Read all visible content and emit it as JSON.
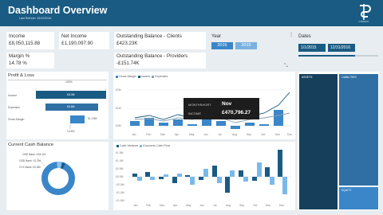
{
  "header": {
    "title": "Dashboard Overview",
    "subtitle": "Last Refresh: 26/12/2016",
    "logo_text": "COMPANY"
  },
  "kpis": {
    "income": {
      "label": "Income",
      "value": "£8,050,115.88"
    },
    "net_income": {
      "label": "Net Income",
      "value": "£1,190,097.90"
    },
    "margin": {
      "label": "Margin %",
      "value": "14.78 %"
    },
    "outstanding_clients": {
      "label": "Outstanding Balance - Clients",
      "value": "£423.23K"
    },
    "outstanding_providers": {
      "label": "Outstanding Balance - Providers",
      "value": "-£151.74K"
    }
  },
  "year": {
    "label": "Year",
    "options": [
      "2016",
      "2015"
    ],
    "selected": "2016"
  },
  "dates": {
    "label": "Dates",
    "start": "1/1/2015",
    "end": "12/31/2016"
  },
  "profit_loss": {
    "title": "Profit & Loss",
    "top_pct": "100%",
    "rows": [
      {
        "label": "Income",
        "value": "£8.0M"
      },
      {
        "label": "Expenses",
        "value": "£6.8M"
      },
      {
        "label": "Gross Margin",
        "value": "£1.19M"
      }
    ],
    "bottom_pct": "14.8%"
  },
  "income_chart": {
    "legend": [
      "Gross Margin",
      "Income",
      "Expenses"
    ],
    "y_ticks": [
      "£2M",
      "£1M",
      "£0M"
    ],
    "months": [
      "Jan",
      "Feb",
      "Mar",
      "Apr",
      "May",
      "Jun",
      "Jul",
      "Aug",
      "Sep",
      "Oct",
      "Nov",
      "Dec"
    ]
  },
  "tooltip": {
    "month_key": "MONTHSHORT",
    "month_val": "Nov",
    "income_key": "INCOME",
    "income_val": "£470,796.27"
  },
  "cash_balance": {
    "title": "Current Cash Balance",
    "labels": [
      "CBD Bank: £18.1M",
      "CBD Bank: £1.2M",
      "XYZ Bank: £0.8M"
    ]
  },
  "cashflow_chart": {
    "legend": [
      "Cash Variance",
      "Economic Cash Flow"
    ],
    "y_ticks": [
      "£1.5M",
      "£1.0M",
      "£0.5M",
      "£0.0M",
      "-£0.5M",
      "-£1.0M",
      "-£1.5M"
    ],
    "months": [
      "Jan",
      "Feb",
      "Mar",
      "Apr",
      "May",
      "Jun",
      "Jul",
      "Aug",
      "Sep",
      "Oct",
      "Nov",
      "Dec"
    ]
  },
  "treemap": {
    "assets": "ASSETS",
    "liabilities": "LIABILITIES",
    "equity": "EQUITY"
  },
  "colors": {
    "header": "#1a5b83",
    "accent": "#3a86c8",
    "dark": "#1b4f72"
  }
}
